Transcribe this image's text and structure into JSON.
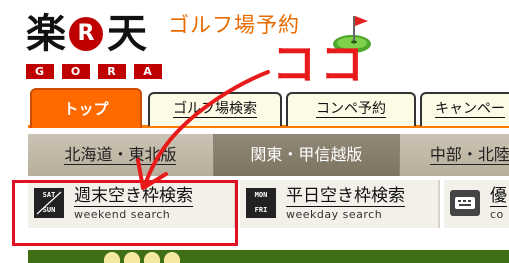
{
  "logo": {
    "kanji_left": "楽",
    "r_letter": "R",
    "kanji_right": "天",
    "gora_letters": [
      "G",
      "O",
      "R",
      "A"
    ]
  },
  "service_title": "ゴルフ場予約",
  "tabs": [
    {
      "label": "トップ",
      "active": true
    },
    {
      "label": "ゴルフ場検索",
      "active": false
    },
    {
      "label": "コンペ予約",
      "active": false
    },
    {
      "label": "キャンペー",
      "active": false
    }
  ],
  "regions": [
    {
      "label": "北海道・東北版",
      "current": false
    },
    {
      "label": "関東・甲信越版",
      "current": true
    },
    {
      "label": "中部・北陸",
      "current": false
    }
  ],
  "search": [
    {
      "badge_top": "SAT",
      "badge_bottom": "SUN",
      "title": "週末空き枠検索",
      "subtitle": "weekend search"
    },
    {
      "badge_top": "MON",
      "badge_bottom": "FRI",
      "title": "平日空き枠検索",
      "subtitle": "weekday search"
    },
    {
      "title": "優",
      "subtitle": "co"
    }
  ],
  "annotation": {
    "text": "ココ",
    "color": "#e81a1a"
  },
  "colors": {
    "brand_red": "#bf0000",
    "tab_orange": "#ff6a00",
    "title_orange": "#e86a00"
  }
}
